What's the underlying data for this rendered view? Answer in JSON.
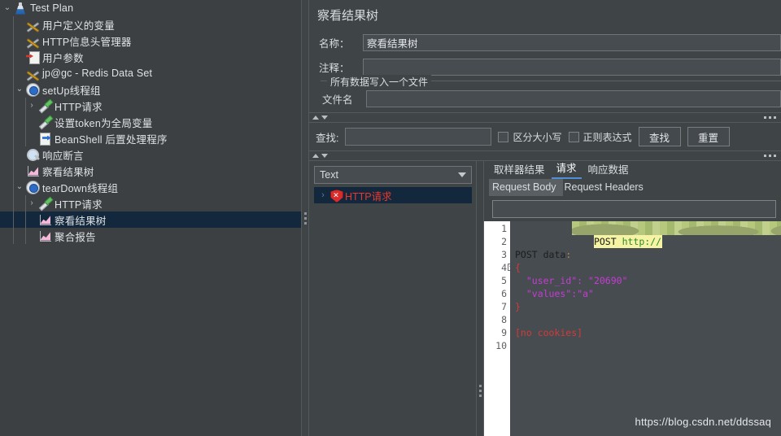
{
  "tree": {
    "items": [
      {
        "label": "Test Plan",
        "icon": "flask-icon",
        "indent": 0,
        "twisty": "down",
        "selected": false
      },
      {
        "label": "用户定义的变量",
        "icon": "tools-icon",
        "indent": 1,
        "twisty": "none",
        "selected": false
      },
      {
        "label": "HTTP信息头管理器",
        "icon": "tools-icon",
        "indent": 1,
        "twisty": "none",
        "selected": false
      },
      {
        "label": "用户参数",
        "icon": "document-red-arrow-icon",
        "indent": 1,
        "twisty": "none",
        "selected": false
      },
      {
        "label": "jp@gc - Redis Data Set",
        "icon": "tools-icon",
        "indent": 1,
        "twisty": "none",
        "selected": false
      },
      {
        "label": "setUp线程组",
        "icon": "gear-icon",
        "indent": 1,
        "twisty": "down",
        "selected": false
      },
      {
        "label": "HTTP请求",
        "icon": "pipette-icon",
        "indent": 2,
        "twisty": "right",
        "selected": false
      },
      {
        "label": "设置token为全局变量",
        "icon": "pipette-icon",
        "indent": 2,
        "twisty": "none",
        "selected": false
      },
      {
        "label": "BeanShell 后置处理程序",
        "icon": "document-blue-arrow-icon",
        "indent": 2,
        "twisty": "none",
        "selected": false
      },
      {
        "label": "响应断言",
        "icon": "magnifier-icon",
        "indent": 1,
        "twisty": "none",
        "selected": false
      },
      {
        "label": "察看结果树",
        "icon": "chart-icon",
        "indent": 1,
        "twisty": "none",
        "selected": false
      },
      {
        "label": "tearDown线程组",
        "icon": "gear-icon",
        "indent": 1,
        "twisty": "down",
        "selected": false
      },
      {
        "label": "HTTP请求",
        "icon": "pipette-icon",
        "indent": 2,
        "twisty": "right",
        "selected": false
      },
      {
        "label": "察看结果树",
        "icon": "chart-icon",
        "indent": 2,
        "twisty": "none",
        "selected": true
      },
      {
        "label": "聚合报告",
        "icon": "chart-icon",
        "indent": 2,
        "twisty": "none",
        "selected": false
      }
    ]
  },
  "panel": {
    "title": "察看结果树",
    "name_label": "名称：",
    "name_value": "察看结果树",
    "comment_label": "注释：",
    "comment_value": "",
    "group_title": "所有数据写入一个文件",
    "filename_label": "文件名",
    "filename_value": ""
  },
  "search": {
    "label": "查找:",
    "value": "",
    "case_sensitive_label": "区分大小写",
    "regex_label": "正则表达式",
    "find_button": "查找",
    "reset_button": "重置"
  },
  "results": {
    "renderer_value": "Text",
    "entries": [
      {
        "label": "HTTP请求",
        "status": "error",
        "selected": true
      }
    ]
  },
  "detail": {
    "main_tabs": [
      {
        "label": "取样器结果",
        "active": false
      },
      {
        "label": "请求",
        "active": true
      },
      {
        "label": "响应数据",
        "active": false
      }
    ],
    "sub_tabs": [
      {
        "label": "Request Body",
        "active": true
      },
      {
        "label": "Request Headers",
        "active": false
      }
    ],
    "body_find_value": ""
  },
  "code": {
    "lines": [
      {
        "num": "1",
        "fold": false
      },
      {
        "num": "2",
        "fold": false
      },
      {
        "num": "3",
        "fold": false
      },
      {
        "num": "4",
        "fold": true
      },
      {
        "num": "5",
        "fold": false
      },
      {
        "num": "6",
        "fold": false
      },
      {
        "num": "7",
        "fold": false
      },
      {
        "num": "8",
        "fold": false
      },
      {
        "num": "9",
        "fold": false
      },
      {
        "num": "10",
        "fold": false
      }
    ],
    "line1_method": "POST ",
    "line1_proto": "http://",
    "line3": "POST data",
    "line3_colon": ":",
    "line4": "{",
    "line5_key": "\"user_id\"",
    "line5_sep": ": ",
    "line5_val": "\"20690\"",
    "line6_key": "\"values\"",
    "line6_sep": ":",
    "line6_val": "\"a\"",
    "line7": "}",
    "line9": "[no cookies]"
  },
  "watermark": "https://blog.csdn.net/ddssaq",
  "colors": {
    "background": "#3f4447",
    "tree_background": "#3c4043",
    "selection": "#13283d",
    "accent": "#4f8fd6",
    "error": "#e8392c",
    "highlight": "#f6f3a4",
    "string": "#c73bd6"
  }
}
